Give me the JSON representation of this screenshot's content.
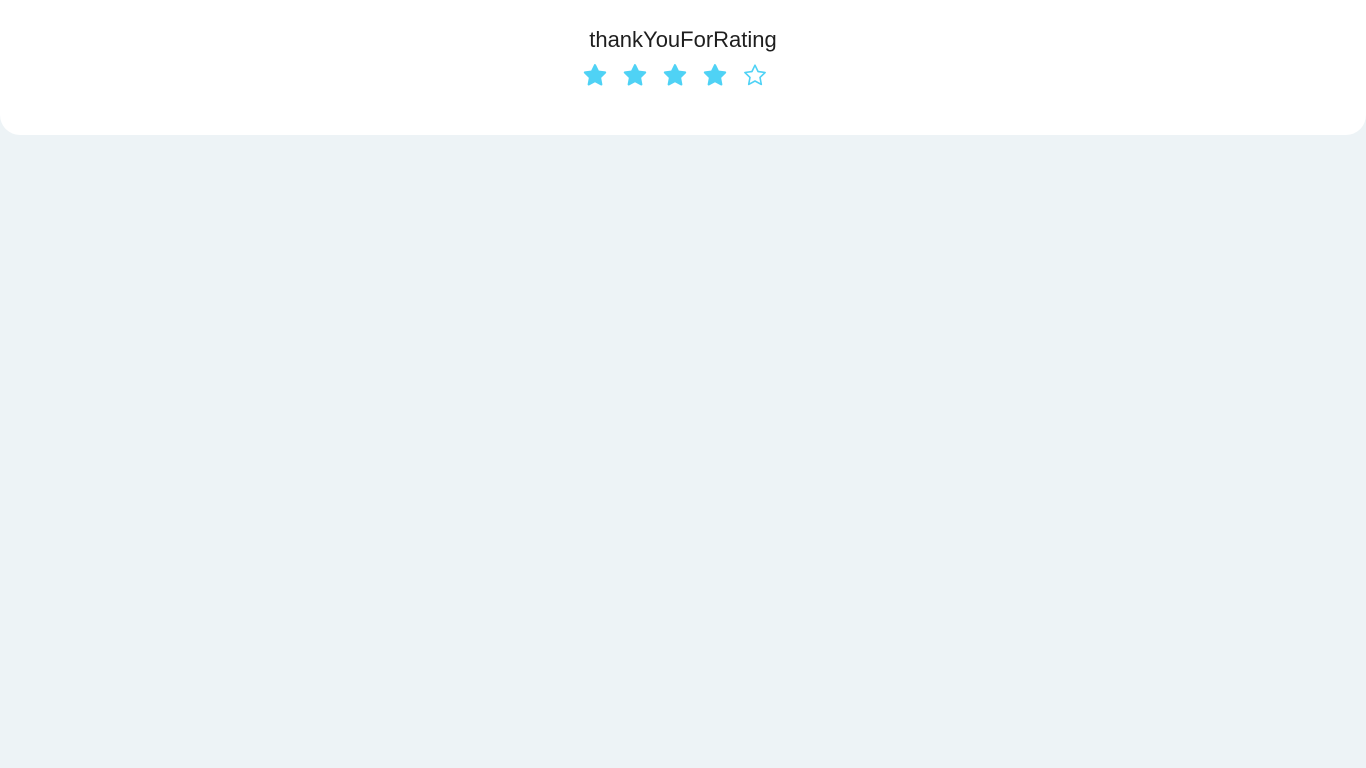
{
  "rating": {
    "title": "thankYouForRating",
    "value": 4,
    "max": 5,
    "accent_color": "#4fd2f5",
    "stars": [
      {
        "icon": "star-filled-icon",
        "filled": true
      },
      {
        "icon": "star-filled-icon",
        "filled": true
      },
      {
        "icon": "star-filled-icon",
        "filled": true
      },
      {
        "icon": "star-filled-icon",
        "filled": true
      },
      {
        "icon": "star-outline-icon",
        "filled": false
      }
    ]
  }
}
